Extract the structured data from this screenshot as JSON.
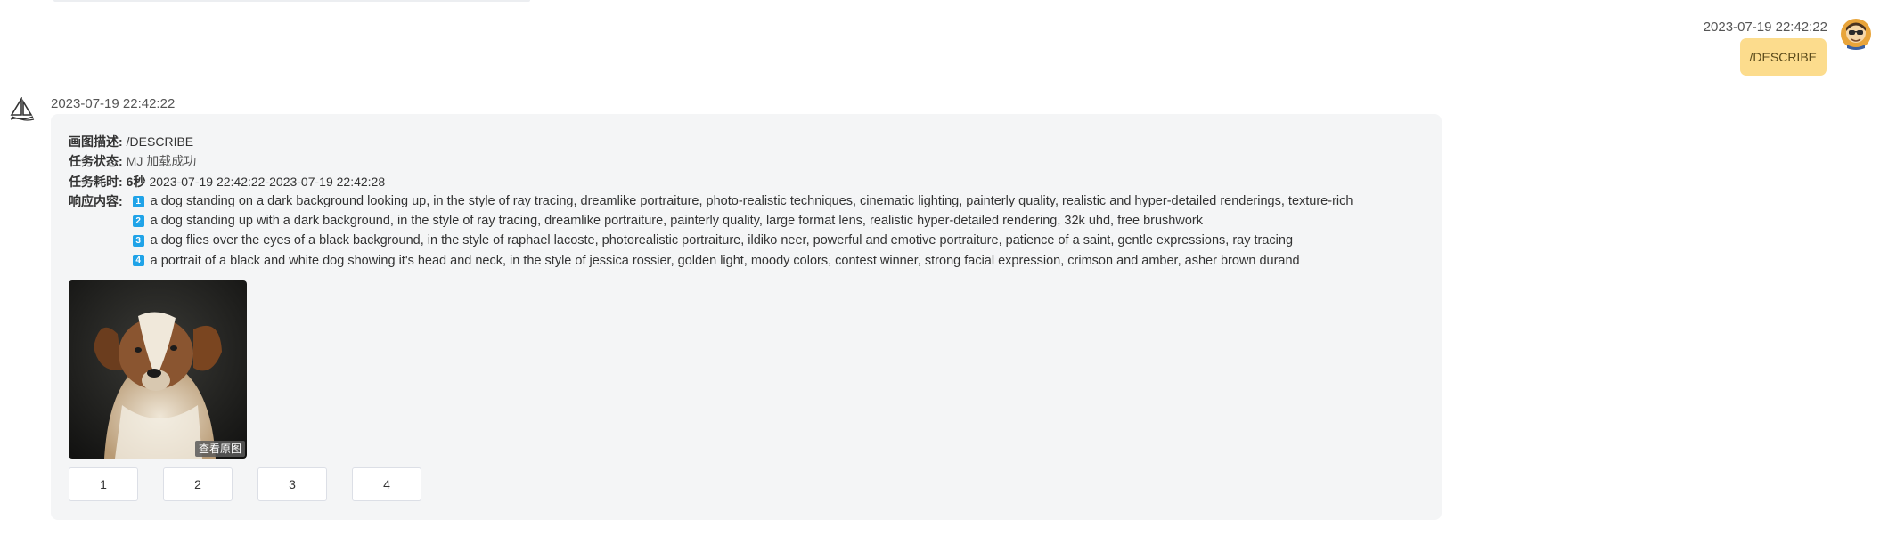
{
  "user_message": {
    "time": "2023-07-19 22:42:22",
    "text": "/DESCRIBE"
  },
  "bot_message": {
    "time": "2023-07-19 22:42:22",
    "fields": {
      "desc_label": "画图描述:",
      "desc_value": "/DESCRIBE",
      "status_label": "任务状态:",
      "status_value": "MJ 加载成功",
      "duration_label": "任务耗时:",
      "duration_secs": "6秒",
      "duration_range": "2023-07-19 22:42:22-2023-07-19 22:42:28",
      "response_label": "响应内容:"
    },
    "responses": [
      {
        "num": "1",
        "text": "a dog standing on a dark background looking up, in the style of ray tracing, dreamlike portraiture, photo-realistic techniques, cinematic lighting, painterly quality, realistic and hyper-detailed renderings, texture-rich"
      },
      {
        "num": "2",
        "text": "a dog standing up with a dark background, in the style of ray tracing, dreamlike portraiture, painterly quality, large format lens, realistic hyper-detailed rendering, 32k uhd, free brushwork"
      },
      {
        "num": "3",
        "text": "a dog flies over the eyes of a black background, in the style of raphael lacoste, photorealistic portraiture, ildiko neer, powerful and emotive portraiture, patience of a saint, gentle expressions, ray tracing"
      },
      {
        "num": "4",
        "text": "a portrait of a black and white dog showing it's head and neck, in the style of jessica rossier, golden light, moody colors, contest winner, strong facial expression, crimson and amber, asher brown durand"
      }
    ],
    "image": {
      "view_original_label": "查看原图",
      "icon": "dog-photo"
    },
    "buttons": [
      "1",
      "2",
      "3",
      "4"
    ]
  },
  "colors": {
    "user_bubble": "#fcdc8d",
    "card_bg": "#f4f5f6",
    "badge": "#1fa3e8"
  }
}
